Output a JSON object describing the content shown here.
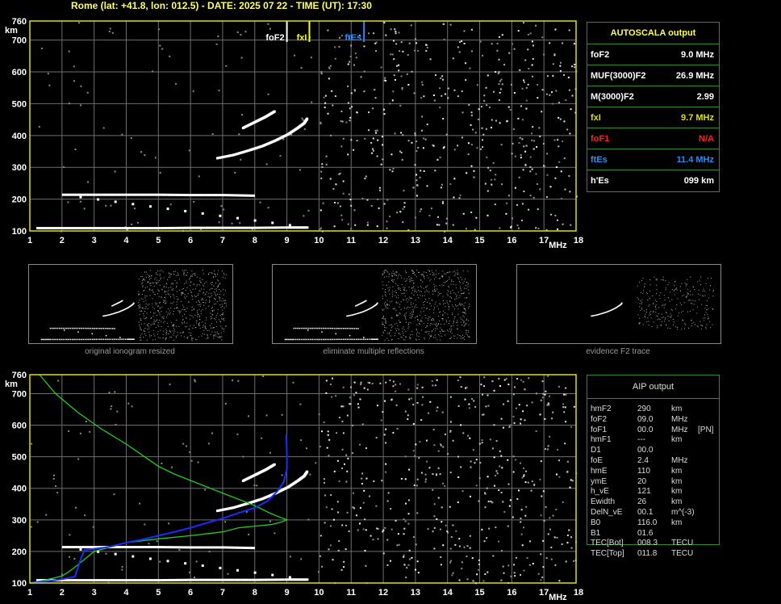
{
  "header": {
    "text": "Rome (lat: +41.8, lon: 012.5) - DATE: 2025 07 22 - TIME (UT): 17:30"
  },
  "colors": {
    "grid": "#6e6e6e",
    "axis": "#e0e000",
    "green_frame": "#2e8b2e",
    "foF2": "#ffffff",
    "fxI": "#ffff00",
    "ftEs": "#1e90ff",
    "foF1": "#ff2020",
    "trace": "#ffffff",
    "profile_green": "#22cc22",
    "profile_blue": "#1a2cff"
  },
  "top_plot": {
    "y_unit": "km",
    "y_ticks": [
      "100",
      "200",
      "300",
      "400",
      "500",
      "600",
      "700",
      "760"
    ],
    "x_ticks": [
      "1",
      "2",
      "3",
      "4",
      "5",
      "6",
      "7",
      "8",
      "9",
      "10",
      "11",
      "12",
      "13",
      "14",
      "15",
      "16",
      "17",
      "18"
    ],
    "x_unit": "MHz",
    "markers": [
      {
        "label": "foF2",
        "freq": 9.0,
        "color": "#ffffff"
      },
      {
        "label": "fxI",
        "freq": 9.7,
        "color": "#ffff00"
      },
      {
        "label": "ftEs",
        "freq": 11.4,
        "color": "#1e90ff"
      }
    ]
  },
  "autoscala": {
    "title": "AUTOSCALA output",
    "rows": [
      {
        "label": "foF2",
        "value": "9.0 MHz",
        "color": "#ffffff"
      },
      {
        "label": "MUF(3000)F2",
        "value": "26.9 MHz",
        "color": "#ffffff"
      },
      {
        "label": "M(3000)F2",
        "value": "2.99",
        "color": "#ffffff"
      },
      {
        "label": "fxI",
        "value": "9.7 MHz",
        "color": "#e0e000"
      },
      {
        "label": "foF1",
        "value": "N/A",
        "color": "#ff2020"
      },
      {
        "label": "ftEs",
        "value": "11.4 MHz",
        "color": "#1e90ff"
      },
      {
        "label": "h'Es",
        "value": "099    km",
        "color": "#ffffff"
      }
    ]
  },
  "thumbnails": [
    {
      "caption": "original ionogram resized"
    },
    {
      "caption": "eliminate multiple reflections"
    },
    {
      "caption": "evidence F2 trace"
    }
  ],
  "bottom_plot": {
    "y_unit": "km",
    "y_ticks": [
      "100",
      "200",
      "300",
      "400",
      "500",
      "600",
      "700",
      "760"
    ],
    "x_ticks": [
      "1",
      "2",
      "3",
      "4",
      "5",
      "6",
      "7",
      "8",
      "9",
      "10",
      "11",
      "12",
      "13",
      "14",
      "15",
      "16",
      "17",
      "18"
    ],
    "x_unit": "MHz"
  },
  "aip": {
    "title": "AIP output",
    "rows": [
      {
        "label": "hmF2",
        "value": "290",
        "unit": "km",
        "extra": ""
      },
      {
        "label": "foF2",
        "value": "09.0",
        "unit": "MHz",
        "extra": ""
      },
      {
        "label": "foF1",
        "value": "00.0",
        "unit": "MHz",
        "extra": "[PN]"
      },
      {
        "label": "hmF1",
        "value": "---",
        "unit": "km",
        "extra": ""
      },
      {
        "label": "D1",
        "value": "00.0",
        "unit": "",
        "extra": ""
      },
      {
        "label": "foE",
        "value": "2.4",
        "unit": "MHz",
        "extra": ""
      },
      {
        "label": "hmE",
        "value": "110",
        "unit": "km",
        "extra": ""
      },
      {
        "label": "ymE",
        "value": "20",
        "unit": "km",
        "extra": ""
      },
      {
        "label": "h_vE",
        "value": "121",
        "unit": "km",
        "extra": ""
      },
      {
        "label": "Ewidth",
        "value": "26",
        "unit": "km",
        "extra": ""
      },
      {
        "label": "DelN_vE",
        "value": "00.1",
        "unit": "m^(-3)",
        "extra": ""
      },
      {
        "label": "B0",
        "value": "116.0",
        "unit": "km",
        "extra": ""
      },
      {
        "label": "B1",
        "value": "01.6",
        "unit": "",
        "extra": ""
      },
      {
        "label": "TEC[Bot]",
        "value": "008.3",
        "unit": "TECU",
        "extra": ""
      },
      {
        "label": "TEC[Top]",
        "value": "011.8",
        "unit": "TECU",
        "extra": ""
      }
    ]
  },
  "chart_data": [
    {
      "type": "scatter",
      "title": "",
      "xlabel": "MHz",
      "ylabel": "km",
      "xlim": [
        1,
        18
      ],
      "ylim": [
        100,
        760
      ],
      "grid": true,
      "series": [
        {
          "values": [
            [
              1.2,
              110
            ],
            [
              2,
              110
            ],
            [
              3,
              110
            ],
            [
              4,
              110
            ],
            [
              5,
              110
            ],
            [
              6,
              111
            ],
            [
              7,
              111
            ],
            [
              8,
              111
            ],
            [
              9,
              112
            ],
            [
              9.6,
              112
            ],
            [
              2,
              215
            ],
            [
              3,
              215
            ],
            [
              4,
              215
            ],
            [
              5,
              215
            ],
            [
              6,
              214
            ],
            [
              7,
              214
            ],
            [
              8,
              212
            ]
          ]
        },
        {
          "values": [
            [
              6.8,
              330
            ],
            [
              7.3,
              340
            ],
            [
              7.8,
              355
            ],
            [
              8.2,
              368
            ],
            [
              8.6,
              385
            ],
            [
              9.0,
              405
            ],
            [
              9.3,
              425
            ],
            [
              9.5,
              440
            ],
            [
              9.6,
              455
            ]
          ]
        },
        {
          "values": [
            [
              7.6,
              425
            ],
            [
              8.0,
              445
            ],
            [
              8.3,
              460
            ],
            [
              8.6,
              478
            ]
          ]
        }
      ]
    },
    {
      "type": "line",
      "title": "",
      "xlabel": "MHz",
      "ylabel": "km",
      "xlim": [
        1,
        18
      ],
      "ylim": [
        100,
        760
      ],
      "grid": true,
      "series": [
        {
          "values": [
            [
              1.3,
              760
            ],
            [
              1.8,
              700
            ],
            [
              2.5,
              640
            ],
            [
              3.2,
              590
            ],
            [
              4.0,
              540
            ],
            [
              4.5,
              505
            ],
            [
              5.0,
              470
            ],
            [
              5.5,
              445
            ],
            [
              6.0,
              425
            ],
            [
              6.5,
              405
            ],
            [
              7.0,
              385
            ],
            [
              7.5,
              365
            ],
            [
              8.0,
              345
            ],
            [
              8.5,
              320
            ],
            [
              8.8,
              308
            ],
            [
              9.0,
              300
            ],
            [
              8.8,
              292
            ],
            [
              8.5,
              285
            ],
            [
              8.0,
              280
            ],
            [
              7.5,
              275
            ],
            [
              7.0,
              262
            ],
            [
              6.0,
              250
            ],
            [
              5.0,
              240
            ],
            [
              4.0,
              228
            ],
            [
              3.0,
              200
            ],
            [
              2.4,
              150
            ],
            [
              2.2,
              135
            ],
            [
              2.0,
              122
            ],
            [
              1.5,
              110
            ],
            [
              1.0,
              100
            ]
          ]
        },
        {
          "values": [
            [
              1.0,
              100
            ],
            [
              1.5,
              105
            ],
            [
              2.0,
              112
            ],
            [
              2.4,
              120
            ],
            [
              2.6,
              180
            ],
            [
              2.7,
              205
            ],
            [
              3.0,
              208
            ],
            [
              3.5,
              215
            ],
            [
              4.0,
              228
            ],
            [
              4.5,
              238
            ],
            [
              5.0,
              250
            ],
            [
              5.5,
              262
            ],
            [
              6.0,
              275
            ],
            [
              6.5,
              290
            ],
            [
              7.0,
              305
            ],
            [
              7.5,
              322
            ],
            [
              8.0,
              338
            ],
            [
              8.4,
              360
            ],
            [
              8.7,
              390
            ],
            [
              8.9,
              420
            ],
            [
              9.0,
              460
            ],
            [
              9.0,
              500
            ],
            [
              8.98,
              570
            ]
          ]
        }
      ]
    }
  ]
}
